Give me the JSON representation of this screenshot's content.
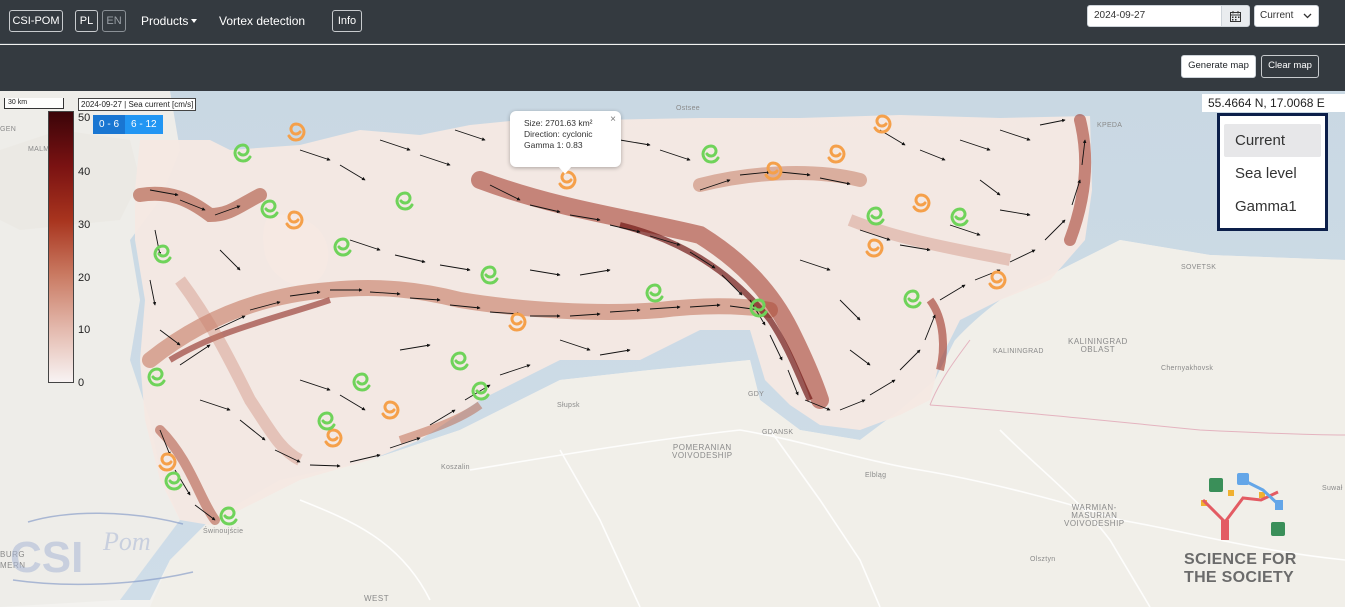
{
  "navbar": {
    "brand": "CSI-POM",
    "lang_pl": "PL",
    "lang_en": "EN",
    "products": "Products",
    "vortex": "Vortex detection",
    "info": "Info",
    "date_value": "2024-09-27",
    "layer_select": "Current"
  },
  "toolbar": {
    "generate_map": "Generate map",
    "clear_map": "Clear map"
  },
  "map": {
    "scale_label": "30 km",
    "legend_title": "2024-09-27 | Sea current [cm/s]",
    "colorbar_ticks": [
      "50",
      "40",
      "30",
      "20",
      "10",
      "0"
    ],
    "colorbar_colors": [
      "#3b0409",
      "#7a1212",
      "#a8341e",
      "#c97961",
      "#e3b8ac",
      "#f8f3f3"
    ],
    "ranges": [
      "0 - 6",
      "6 - 12"
    ],
    "coordinates": "55.4664 N, 17.0068 E",
    "popup": {
      "size": "Size: 2701.63 km²",
      "direction": "Direction: cyclonic",
      "gamma": "Gamma 1: 0.83",
      "close": "×"
    },
    "layers": [
      "Current",
      "Sea level",
      "Gamma1"
    ],
    "place_labels": {
      "ostsee": "Ostsee",
      "slupsk": "Słupsk",
      "koszalin": "Koszalin",
      "gdy": "GDY",
      "gdansk": "GDANSK",
      "pomeranian": "POMERANIAN",
      "voivodeship": "VOIVODESHIP",
      "elblag": "Elbląg",
      "kaliningrad": "KALININGRAD",
      "kaliningrad_oblast1": "KALININGRAD",
      "kaliningrad_oblast2": "OBLAST",
      "sovetsk": "SOVETSK",
      "chernyakhovsk": "Chernyakhovsk",
      "warmian1": "WARMIAN-",
      "warmian2": "MASURIAN",
      "warmian3": "VOIVODESHIP",
      "olsztyn": "Olsztyn",
      "suwalki": "Suwał",
      "west": "WEST",
      "burg": "BURG",
      "mern": "MERN",
      "swinoujscie": "Świnoujście",
      "malmo": "MALM",
      "gen": "GEN",
      "kpeda": "KPEDA"
    },
    "vortex_colors": {
      "cyclonic": "#f5a04a",
      "anticyclonic": "#6fd35a"
    }
  },
  "logos": {
    "csipom": "CSI POM",
    "sfs_line1": "SCIENCE FOR",
    "sfs_line2": "THE SOCIETY"
  }
}
